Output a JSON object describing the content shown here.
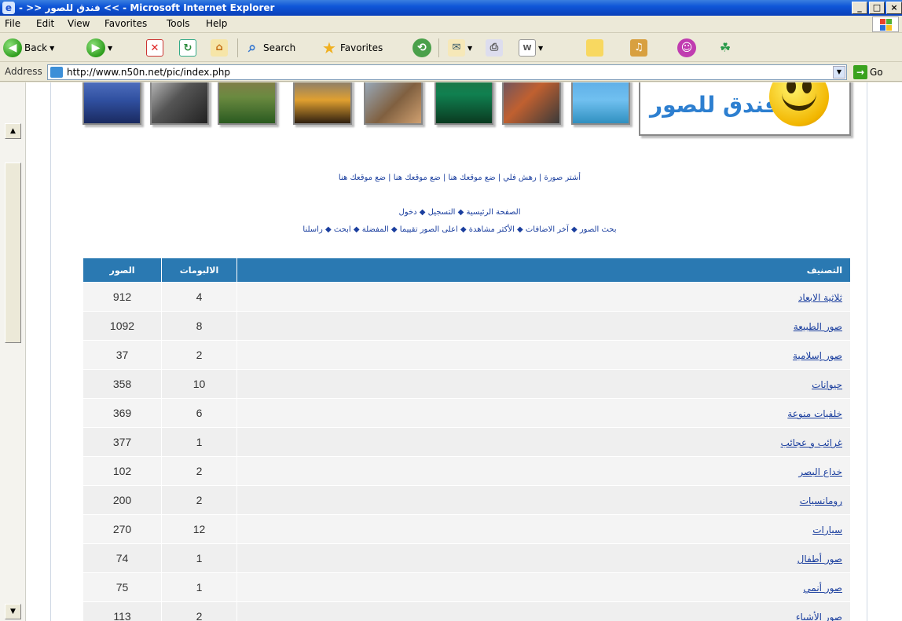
{
  "window": {
    "title": "- >> فندق للصور << - Microsoft Internet Explorer",
    "controls": [
      "_",
      "□",
      "×"
    ]
  },
  "menu": [
    "File",
    "Edit",
    "View",
    "Favorites",
    "Tools",
    "Help"
  ],
  "toolbar": {
    "back_label": "Back",
    "search_label": "Search",
    "favorites_label": "Favorites"
  },
  "address": {
    "label": "Address",
    "url": "http://www.n50n.net/pic/index.php",
    "go_label": "Go"
  },
  "site": {
    "logo_text": "فندق للصور",
    "links_row1": "أشتر صورة | رهش فلي | ضع موقعك هنا | ضع موقعك هنا | ضع موقعك هنا",
    "nav_row1": "الصفحة الرئيسية ◆ التسجيل ◆ دخول",
    "nav_row2": "بحث الصور ◆ آخر الاضافات ◆ الأكثر مشاهدة ◆ اعلى الصور تقييما ◆ المفضلة ◆ ابحث ◆ راسلنا"
  },
  "table": {
    "headers": {
      "images": "الصور",
      "albums": "الالبومات",
      "category": "التصنيف"
    },
    "rows": [
      {
        "images": "912",
        "albums": "4",
        "category": "ثلاثية الابعاد"
      },
      {
        "images": "1092",
        "albums": "8",
        "category": "صور الطبيعة"
      },
      {
        "images": "37",
        "albums": "2",
        "category": "صور إسلامية"
      },
      {
        "images": "358",
        "albums": "10",
        "category": "حيوانات"
      },
      {
        "images": "369",
        "albums": "6",
        "category": "خلفيات منوعة"
      },
      {
        "images": "377",
        "albums": "1",
        "category": "غرائب و عجائب"
      },
      {
        "images": "102",
        "albums": "2",
        "category": "خداع البصر"
      },
      {
        "images": "200",
        "albums": "2",
        "category": "رومانسيات"
      },
      {
        "images": "270",
        "albums": "12",
        "category": "سيارات"
      },
      {
        "images": "74",
        "albums": "1",
        "category": "صور أطفال"
      },
      {
        "images": "75",
        "albums": "1",
        "category": "صور أنمي"
      },
      {
        "images": "113",
        "albums": "2",
        "category": "صور الأشياء"
      }
    ]
  },
  "colors": {
    "header_blue": "#2a79b2",
    "link_blue": "#1a3e9e",
    "xp_title": "#0f56d8"
  }
}
